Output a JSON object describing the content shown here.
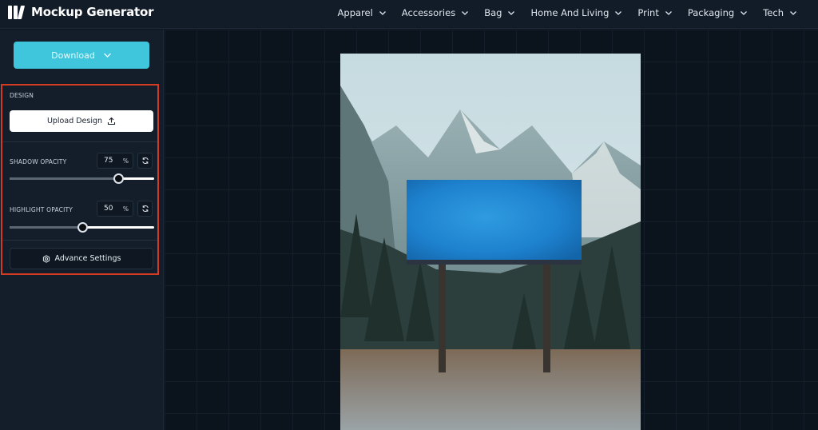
{
  "app": {
    "title": "Mockup Generator"
  },
  "nav": {
    "items": [
      {
        "label": "Apparel"
      },
      {
        "label": "Accessories"
      },
      {
        "label": "Bag"
      },
      {
        "label": "Home And Living"
      },
      {
        "label": "Print"
      },
      {
        "label": "Packaging"
      },
      {
        "label": "Tech"
      }
    ]
  },
  "sidebar": {
    "download_label": "Download",
    "design": {
      "section_label": "DESIGN",
      "upload_label": "Upload Design",
      "shadow": {
        "label": "SHADOW OPACITY",
        "value": "75",
        "unit": "%",
        "level": 0.75
      },
      "highlight": {
        "label": "HIGHLIGHT OPACITY",
        "value": "50",
        "unit": "%",
        "level": 0.5
      },
      "advance_label": "Advance Settings"
    }
  },
  "colors": {
    "accent": "#3fc6dc",
    "highlight_border": "#d43b23",
    "billboard": "#1a7fd0",
    "background": "#0d1520"
  },
  "preview": {
    "scene": "billboard-in-mountain-forest"
  }
}
